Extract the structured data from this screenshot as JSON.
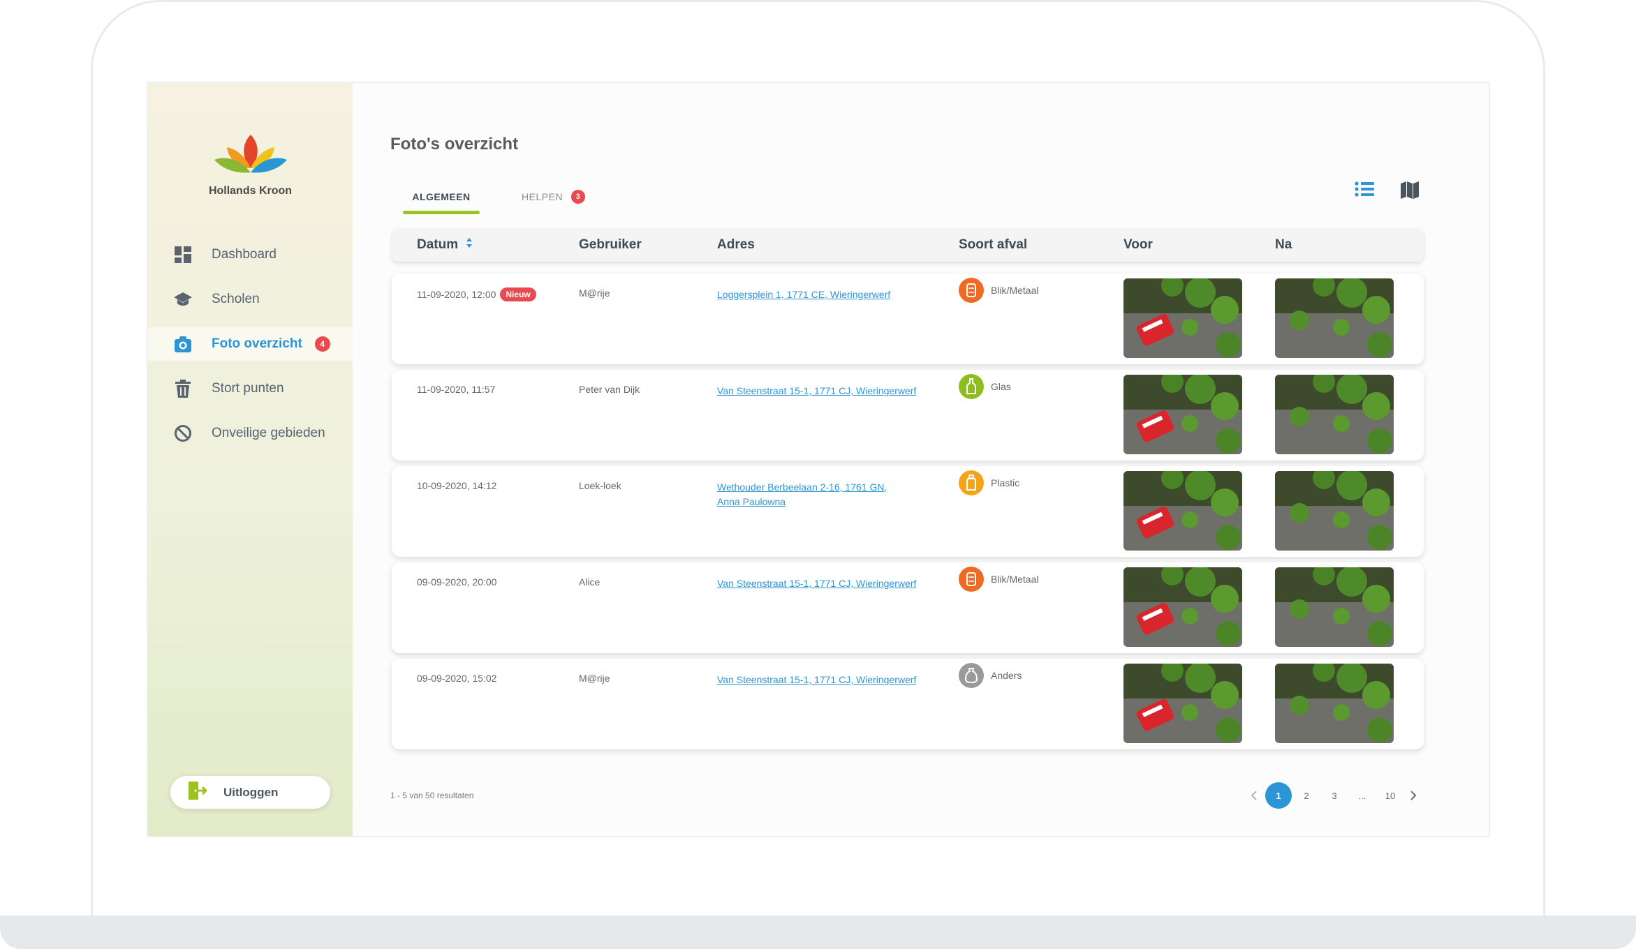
{
  "brand": {
    "name": "Hollands Kroon"
  },
  "sidebar": {
    "items": [
      {
        "label": "Dashboard",
        "icon": "dashboard-icon"
      },
      {
        "label": "Scholen",
        "icon": "graduation-cap-icon"
      },
      {
        "label": "Foto overzicht",
        "icon": "camera-icon",
        "badge": "4"
      },
      {
        "label": "Stort punten",
        "icon": "trash-icon"
      },
      {
        "label": "Onveilige gebieden",
        "icon": "block-icon"
      }
    ],
    "logout_label": "Uitloggen"
  },
  "page": {
    "title": "Foto's overzicht"
  },
  "tabs": [
    {
      "label": "ALGEMEEN",
      "active": true
    },
    {
      "label": "HELPEN",
      "badge": "3"
    }
  ],
  "table": {
    "columns": [
      "Datum",
      "Gebruiker",
      "Adres",
      "Soort afval",
      "Voor",
      "Na"
    ],
    "rows": [
      {
        "date": "11-09-2020, 12:00",
        "new_label": "Nieuw",
        "user": "M@rije",
        "address": "Loggersplein 1, 1771 CE, Wieringerwerf",
        "type": "Blik/Metaal"
      },
      {
        "date": "11-09-2020, 11:57",
        "user": "Peter van Dijk",
        "address": "Van Steenstraat 15-1, 1771 CJ, Wieringerwerf",
        "type": "Glas"
      },
      {
        "date": "10-09-2020, 14:12",
        "user": "Loek-loek",
        "address": "Wethouder Berbeelaan 2-16, 1761 GN, Anna Paulowna",
        "type": "Plastic"
      },
      {
        "date": "09-09-2020, 20:00",
        "user": "Alice",
        "address": "Van Steenstraat 15-1, 1771 CJ, Wieringerwerf",
        "type": "Blik/Metaal"
      },
      {
        "date": "09-09-2020, 15:02",
        "user": "M@rije",
        "address": "Van Steenstraat 15-1, 1771 CJ, Wieringerwerf",
        "type": "Anders"
      }
    ]
  },
  "type_colors": {
    "Blik/Metaal": "#ef6a22",
    "Glas": "#8dbd1e",
    "Plastic": "#f3a51a",
    "Anders": "#9a9a9a"
  },
  "accent": {
    "blue": "#2b95d6",
    "green": "#9cc31d",
    "red": "#e84a4f"
  },
  "footer": {
    "results": "1 - 5 van 50 resultaten"
  },
  "pagination": {
    "pages": [
      "1",
      "2",
      "3",
      "...",
      "10"
    ],
    "current": "1"
  }
}
